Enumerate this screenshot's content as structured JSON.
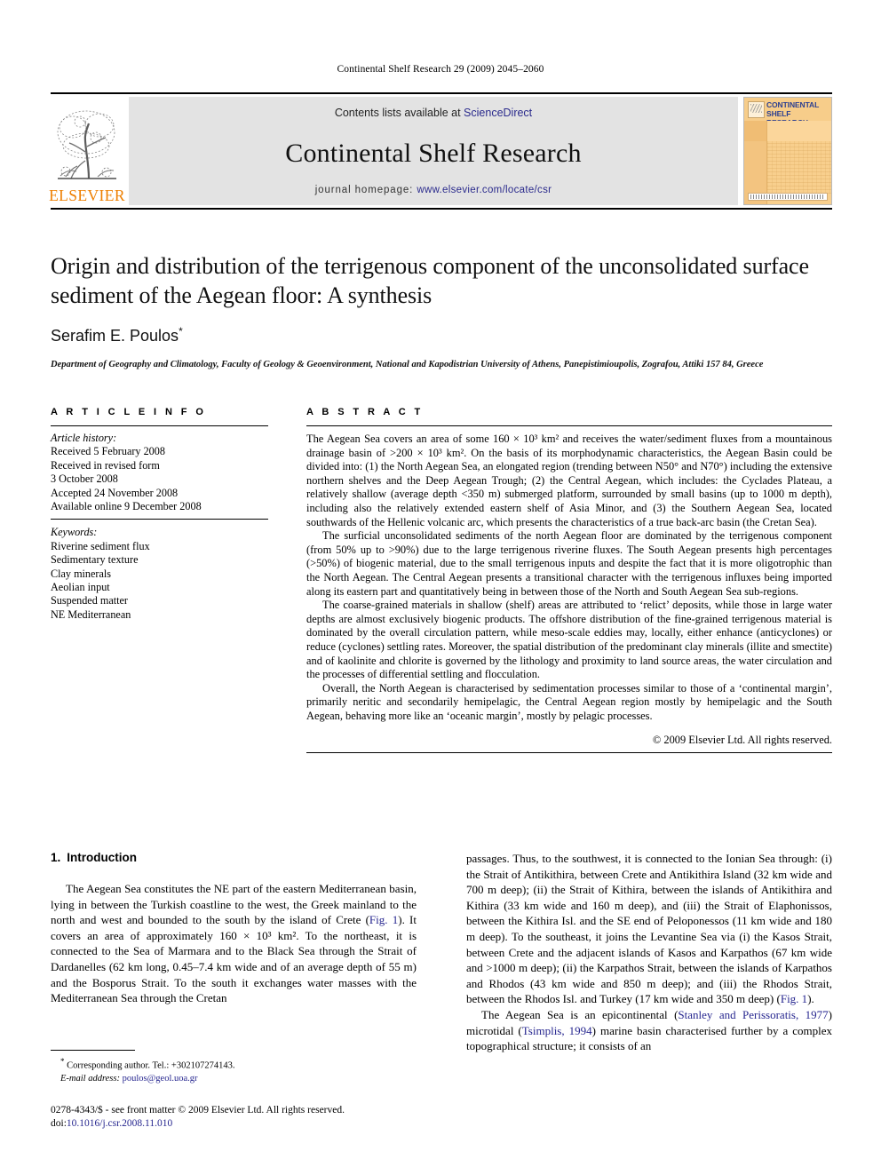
{
  "running_head": "Continental Shelf Research 29 (2009) 2045–2060",
  "masthead": {
    "publisher_word": "ELSEVIER",
    "contents_prefix": "Contents lists available at ",
    "contents_link": "ScienceDirect",
    "journal_title": "Continental Shelf Research",
    "homepage_prefix": "journal homepage: ",
    "homepage_url": "www.elsevier.com/locate/csr",
    "cover_title_line1": "CONTINENTAL",
    "cover_title_line2": "SHELF RESEARCH"
  },
  "article": {
    "title": "Origin and distribution of the terrigenous component of the unconsolidated surface sediment of the Aegean floor: A synthesis",
    "authors": "Serafim E. Poulos",
    "author_marker": "*",
    "affiliation": "Department of Geography and Climatology, Faculty of Geology & Geoenvironment, National and Kapodistrian University of Athens, Panepistimioupolis, Zografou, Attiki 157 84, Greece"
  },
  "info": {
    "heading": "A R T I C L E   I N F O",
    "history_label": "Article history:",
    "history": [
      "Received 5 February 2008",
      "Received in revised form",
      "3 October 2008",
      "Accepted 24 November 2008",
      "Available online 9 December 2008"
    ],
    "keywords_label": "Keywords:",
    "keywords": [
      "Riverine sediment flux",
      "Sedimentary texture",
      "Clay minerals",
      "Aeolian input",
      "Suspended matter",
      "NE Mediterranean"
    ]
  },
  "abstract": {
    "heading": "A B S T R A C T",
    "paragraphs": [
      "The Aegean Sea covers an area of some 160 × 10³ km² and receives the water/sediment fluxes from a mountainous drainage basin of >200 × 10³ km². On the basis of its morphodynamic characteristics, the Aegean Basin could be divided into: (1) the North Aegean Sea, an elongated region (trending between N50° and N70°) including the extensive northern shelves and the Deep Aegean Trough; (2) the Central Aegean, which includes: the Cyclades Plateau, a relatively shallow (average depth <350 m) submerged platform, surrounded by small basins (up to 1000 m depth), including also the relatively extended eastern shelf of Asia Minor, and (3) the Southern Aegean Sea, located southwards of the Hellenic volcanic arc, which presents the characteristics of a true back-arc basin (the Cretan Sea).",
      "The surficial unconsolidated sediments of the north Aegean floor are dominated by the terrigenous component (from 50% up to >90%) due to the large terrigenous riverine fluxes. The South Aegean presents high percentages (>50%) of biogenic material, due to the small terrigenous inputs and despite the fact that it is more oligotrophic than the North Aegean. The Central Aegean presents a transitional character with the terrigenous influxes being imported along its eastern part and quantitatively being in between those of the North and South Aegean Sea sub-regions.",
      "The coarse-grained materials in shallow (shelf) areas are attributed to ‘relict’ deposits, while those in large water depths are almost exclusively biogenic products. The offshore distribution of the fine-grained terrigenous material is dominated by the overall circulation pattern, while meso-scale eddies may, locally, either enhance (anticyclones) or reduce (cyclones) settling rates. Moreover, the spatial distribution of the predominant clay minerals (illite and smectite) and of kaolinite and chlorite is governed by the lithology and proximity to land source areas, the water circulation and the processes of differential settling and flocculation.",
      "Overall, the North Aegean is characterised by sedimentation processes similar to those of a ‘continental margin’, primarily neritic and secondarily hemipelagic, the Central Aegean region mostly by hemipelagic and the South Aegean, behaving more like an ‘oceanic margin’, mostly by pelagic processes."
    ],
    "copyright": "© 2009 Elsevier Ltd. All rights reserved."
  },
  "introduction": {
    "number": "1.",
    "title": "Introduction",
    "left_paragraph_part1": "The Aegean Sea constitutes the NE part of the eastern Mediterranean basin, lying in between the Turkish coastline to the west, the Greek mainland to the north and west and bounded to the south by the island of Crete (",
    "left_fig_ref": "Fig. 1",
    "left_paragraph_part2": "). It covers an area of approximately 160 × 10³ km². To the northeast, it is connected to the Sea of Marmara and to the Black Sea through the Strait of Dardanelles (62 km long, 0.45–7.4 km wide and of an average depth of 55 m) and the Bosporus Strait. To the south it exchanges water masses with the Mediterranean Sea through the Cretan",
    "right_paragraph_part1": "passages. Thus, to the southwest, it is connected to the Ionian Sea through: (i) the Strait of Antikithira, between Crete and Antikithira Island (32 km wide and 700 m deep); (ii) the Strait of Kithira, between the islands of Antikithira and Kithira (33 km wide and 160 m deep), and (iii) the Strait of Elaphonissos, between the Kithira Isl. and the SE end of Peloponessos (11 km wide and 180 m deep). To the southeast, it joins the Levantine Sea via (i) the Kasos Strait, between Crete and the adjacent islands of Kasos and Karpathos (67 km wide and >1000 m deep); (ii) the Karpathos Strait, between the islands of Karpathos and Rhodos (43 km wide and 850 m deep); and (iii) the Rhodos Strait, between the Rhodos Isl. and Turkey (17 km wide and 350 m deep) (",
    "right_fig_ref": "Fig. 1",
    "right_paragraph_part2": ").",
    "right_paragraph2_part1": "The Aegean Sea is an epicontinental (",
    "right_cite1": "Stanley and Perissoratis, 1977",
    "right_paragraph2_part2": ") microtidal (",
    "right_cite2": "Tsimplis, 1994",
    "right_paragraph2_part3": ") marine basin characterised further by a complex topographical structure; it consists of an"
  },
  "footnote": {
    "marker": "*",
    "corresponding": "Corresponding author. Tel.: +302107274143.",
    "email_label": "E-mail address:",
    "email": "poulos@geol.uoa.gr"
  },
  "imprint": {
    "line1_prefix": "0278-4343/$ - see front matter ",
    "line1_suffix": "© 2009 Elsevier Ltd. All rights reserved.",
    "doi_label": "doi:",
    "doi_value": "10.1016/j.csr.2008.11.010"
  },
  "colors": {
    "link": "#26268f",
    "elsevier_orange": "#ee7f00",
    "band_gray": "#e3e3e3",
    "cover_orange": "#f5c77e"
  }
}
